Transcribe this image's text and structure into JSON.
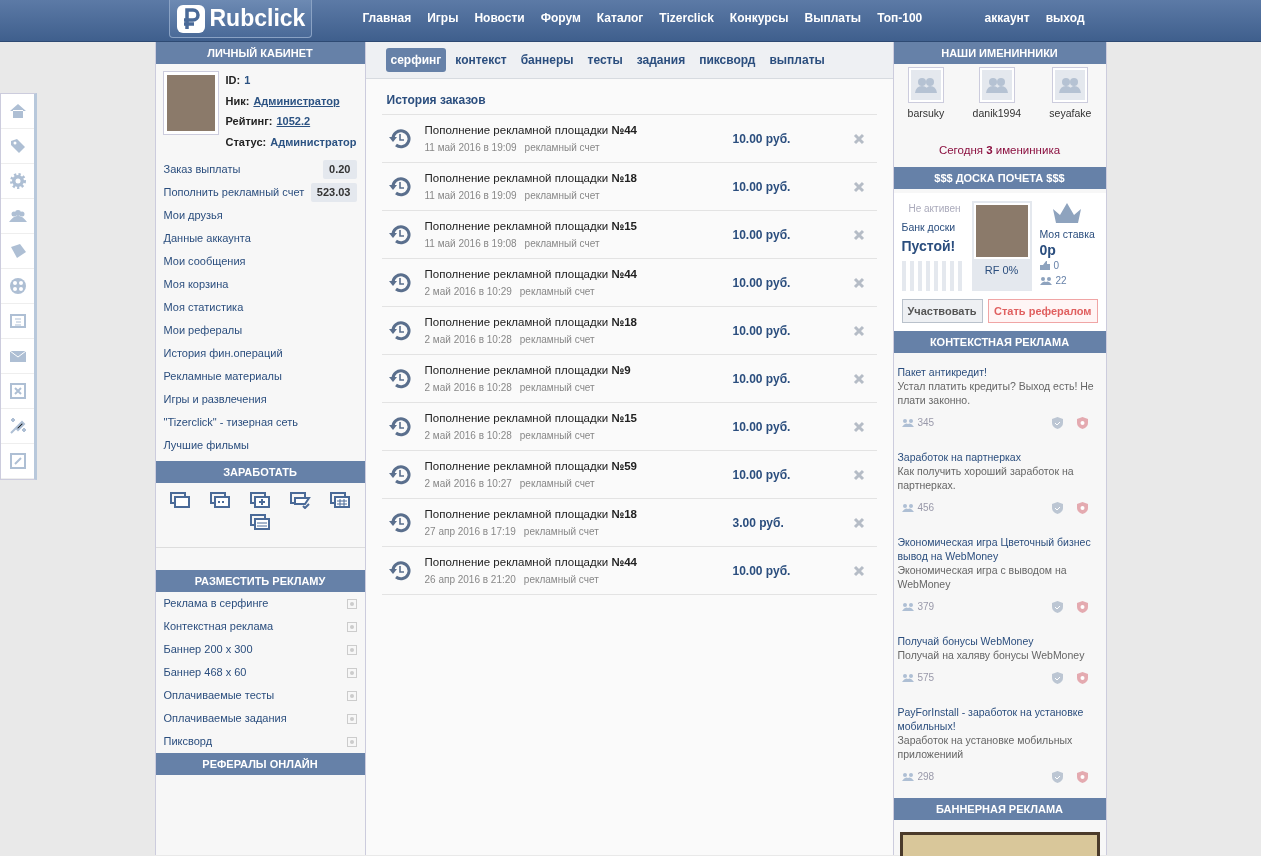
{
  "header": {
    "logo_text": "Rubclick",
    "nav": [
      "Главная",
      "Игры",
      "Новости",
      "Форум",
      "Каталог",
      "Tizerclick",
      "Конкурсы",
      "Выплаты",
      "Топ-100"
    ],
    "user_links": [
      "аккаунт",
      "выход"
    ]
  },
  "profile": {
    "title": "ЛИЧНЫЙ КАБИНЕТ",
    "fields": [
      {
        "label": "ID:",
        "value": "1",
        "link": false
      },
      {
        "label": "Ник:",
        "value": "Администратор",
        "link": true
      },
      {
        "label": "Рейтинг:",
        "value": "1052.2",
        "link": true
      },
      {
        "label": "Статус:",
        "value": "Администратор",
        "link": false
      }
    ],
    "menu": [
      {
        "label": "Заказ выплаты",
        "value": "0.20"
      },
      {
        "label": "Пополнить рекламный счет",
        "value": "523.03"
      },
      {
        "label": "Мои друзья"
      },
      {
        "label": "Данные аккаунта"
      },
      {
        "label": "Мои сообщения"
      },
      {
        "label": "Моя корзина"
      },
      {
        "label": "Моя статистика"
      },
      {
        "label": "Мои рефералы"
      },
      {
        "label": "История фин.операций"
      },
      {
        "label": "Рекламные материалы"
      },
      {
        "label": "Игры и развлечения"
      },
      {
        "label": "\"Tizerclick\" - тизерная сеть"
      },
      {
        "label": "Лучшие фильмы"
      }
    ]
  },
  "earn": {
    "title": "ЗАРАБОТАТЬ"
  },
  "advertise": {
    "title": "РАЗМЕСТИТЬ РЕКЛАМУ",
    "items": [
      "Реклама в серфинге",
      "Контекстная реклама",
      "Баннер 200 x 300",
      "Баннер 468 x 60",
      "Оплачиваемые тесты",
      "Оплачиваемые задания",
      "Пиксворд"
    ]
  },
  "referrals": {
    "title": "РЕФЕРАЛЫ ОНЛАЙН"
  },
  "tabs": [
    {
      "label": "серфинг",
      "selected": true
    },
    {
      "label": "контекст",
      "selected": false
    },
    {
      "label": "баннеры",
      "selected": false
    },
    {
      "label": "тесты",
      "selected": false
    },
    {
      "label": "задания",
      "selected": false
    },
    {
      "label": "пиксворд",
      "selected": false
    },
    {
      "label": "выплаты",
      "selected": false
    }
  ],
  "orders": {
    "title": "История заказов",
    "rows": [
      {
        "title": "Пополнение рекламной площадки **№44**",
        "date": "11 май 2016 в 19:09",
        "account": "рекламный счет",
        "amount": "10.00 руб."
      },
      {
        "title": "Пополнение рекламной площадки **№18**",
        "date": "11 май 2016 в 19:09",
        "account": "рекламный счет",
        "amount": "10.00 руб."
      },
      {
        "title": "Пополнение рекламной площадки **№15**",
        "date": "11 май 2016 в 19:08",
        "account": "рекламный счет",
        "amount": "10.00 руб."
      },
      {
        "title": "Пополнение рекламной площадки **№44**",
        "date": "2 май 2016 в 10:29",
        "account": "рекламный счет",
        "amount": "10.00 руб."
      },
      {
        "title": "Пополнение рекламной площадки **№18**",
        "date": "2 май 2016 в 10:28",
        "account": "рекламный счет",
        "amount": "10.00 руб."
      },
      {
        "title": "Пополнение рекламной площадки **№9**",
        "date": "2 май 2016 в 10:28",
        "account": "рекламный счет",
        "amount": "10.00 руб."
      },
      {
        "title": "Пополнение рекламной площадки **№15**",
        "date": "2 май 2016 в 10:28",
        "account": "рекламный счет",
        "amount": "10.00 руб."
      },
      {
        "title": "Пополнение рекламной площадки **№59**",
        "date": "2 май 2016 в 10:27",
        "account": "рекламный счет",
        "amount": "10.00 руб."
      },
      {
        "title": "Пополнение рекламной площадки **№18**",
        "date": "27 апр 2016 в 17:19",
        "account": "рекламный счет",
        "amount": "3.00 руб."
      },
      {
        "title": "Пополнение рекламной площадки **№44**",
        "date": "26 апр 2016 в 21:20",
        "account": "рекламный счет",
        "amount": "10.00 руб."
      }
    ]
  },
  "birthdays": {
    "title": "НАШИ ИМЕНИННИКИ",
    "users": [
      "barsuky",
      "danik1994",
      "seyafake"
    ],
    "today": "Сегодня **3** именинника"
  },
  "honor_board": {
    "title": "$$$ ДОСКА ПОЧЕТА $$$",
    "status": "Не активен",
    "bank_label": "Банк доски",
    "bank_value": "Пустой!",
    "rf": "RF 0%",
    "bid_label": "Моя ставка",
    "bid": "0р",
    "likes": "0",
    "referrals": "22",
    "buttons": [
      "Участвовать",
      "Стать рефералом"
    ]
  },
  "context_ads": {
    "title": "КОНТЕКСТНАЯ РЕКЛАМА",
    "ads": [
      {
        "title": "Пакет антикредит!",
        "text": "Устал платить кредиты? Выход есть! Не плати законно.",
        "count": "345"
      },
      {
        "title": "Заработок на партнерках",
        "text": "Как получить хороший заработок на партнерках.",
        "count": "456"
      },
      {
        "title": "Экономическая игра Цветочный бизнес вывод на WebMoney",
        "text": "Экономическая игра с выводом на WebMoney",
        "count": "379"
      },
      {
        "title": "Получай бонусы WebMoney",
        "text": "Получай на халяву бонусы WebMoney",
        "count": "575"
      },
      {
        "title": "PayForInstall - заработок на установке мобильных!",
        "text": "Заработок на установке мобильных приложениий",
        "count": "298"
      }
    ]
  },
  "banner_ads": {
    "title": "БАННЕРНАЯ РЕКЛАМА"
  }
}
